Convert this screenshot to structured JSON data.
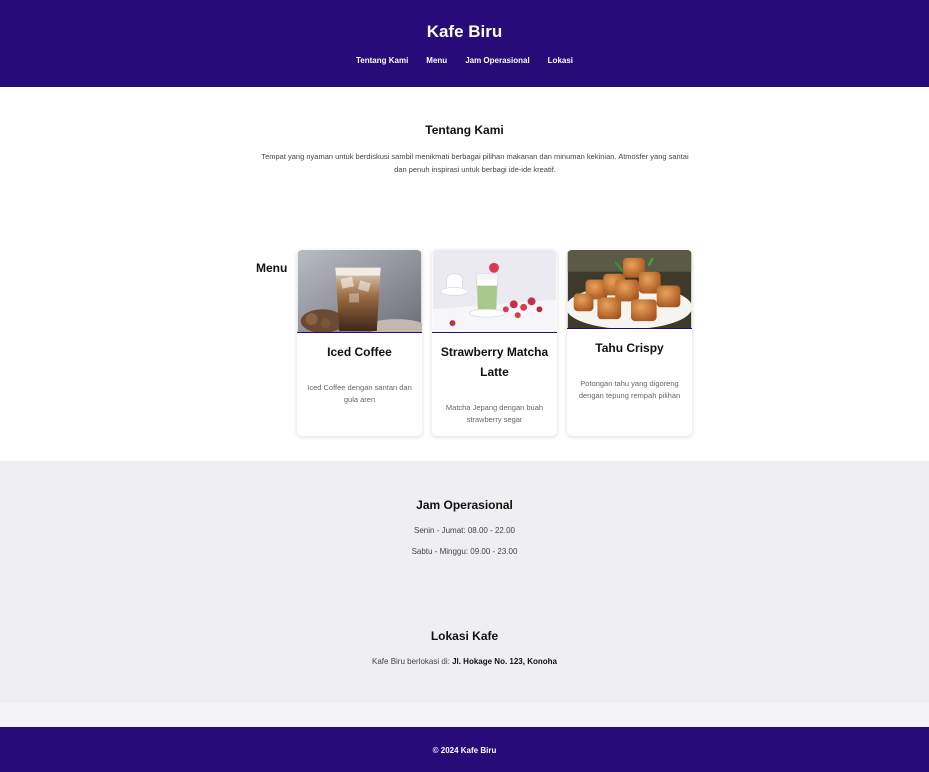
{
  "header": {
    "title": "Kafe Biru",
    "nav": [
      "Tentang Kami",
      "Menu",
      "Jam Operasional",
      "Lokasi"
    ]
  },
  "about": {
    "heading": "Tentang Kami",
    "text": "Tempat yang nyaman untuk berdiskusi sambil menikmati berbagai pilihan makanan dan minuman kekinian. Atmosfer yang santai dan penuh inspirasi untuk berbagi ide-ide kreatif."
  },
  "menu": {
    "heading": "Menu",
    "items": [
      {
        "title": "Iced Coffee",
        "desc": "Iced Coffee dengan santan dan gula aren"
      },
      {
        "title": "Strawberry Matcha Latte",
        "desc": "Matcha Jepang dengan buah strawberry segar"
      },
      {
        "title": "Tahu Crispy",
        "desc": "Potongan tahu yang digoreng dengan tepung rempah pilihan"
      }
    ]
  },
  "hours": {
    "heading": "Jam Operasional",
    "weekday": "Senin - Jumat: 08.00 - 22.00",
    "weekend": "Sabtu - Minggu: 09.00 - 23.00"
  },
  "location": {
    "heading": "Lokasi Kafe",
    "prefix": "Kafe Biru berlokasi di: ",
    "address": "Jl. Hokage No. 123, Konoha"
  },
  "footer": {
    "text": "© 2024 Kafe Biru"
  },
  "colors": {
    "primary": "#270b78",
    "section_bg": "#efeff2"
  }
}
